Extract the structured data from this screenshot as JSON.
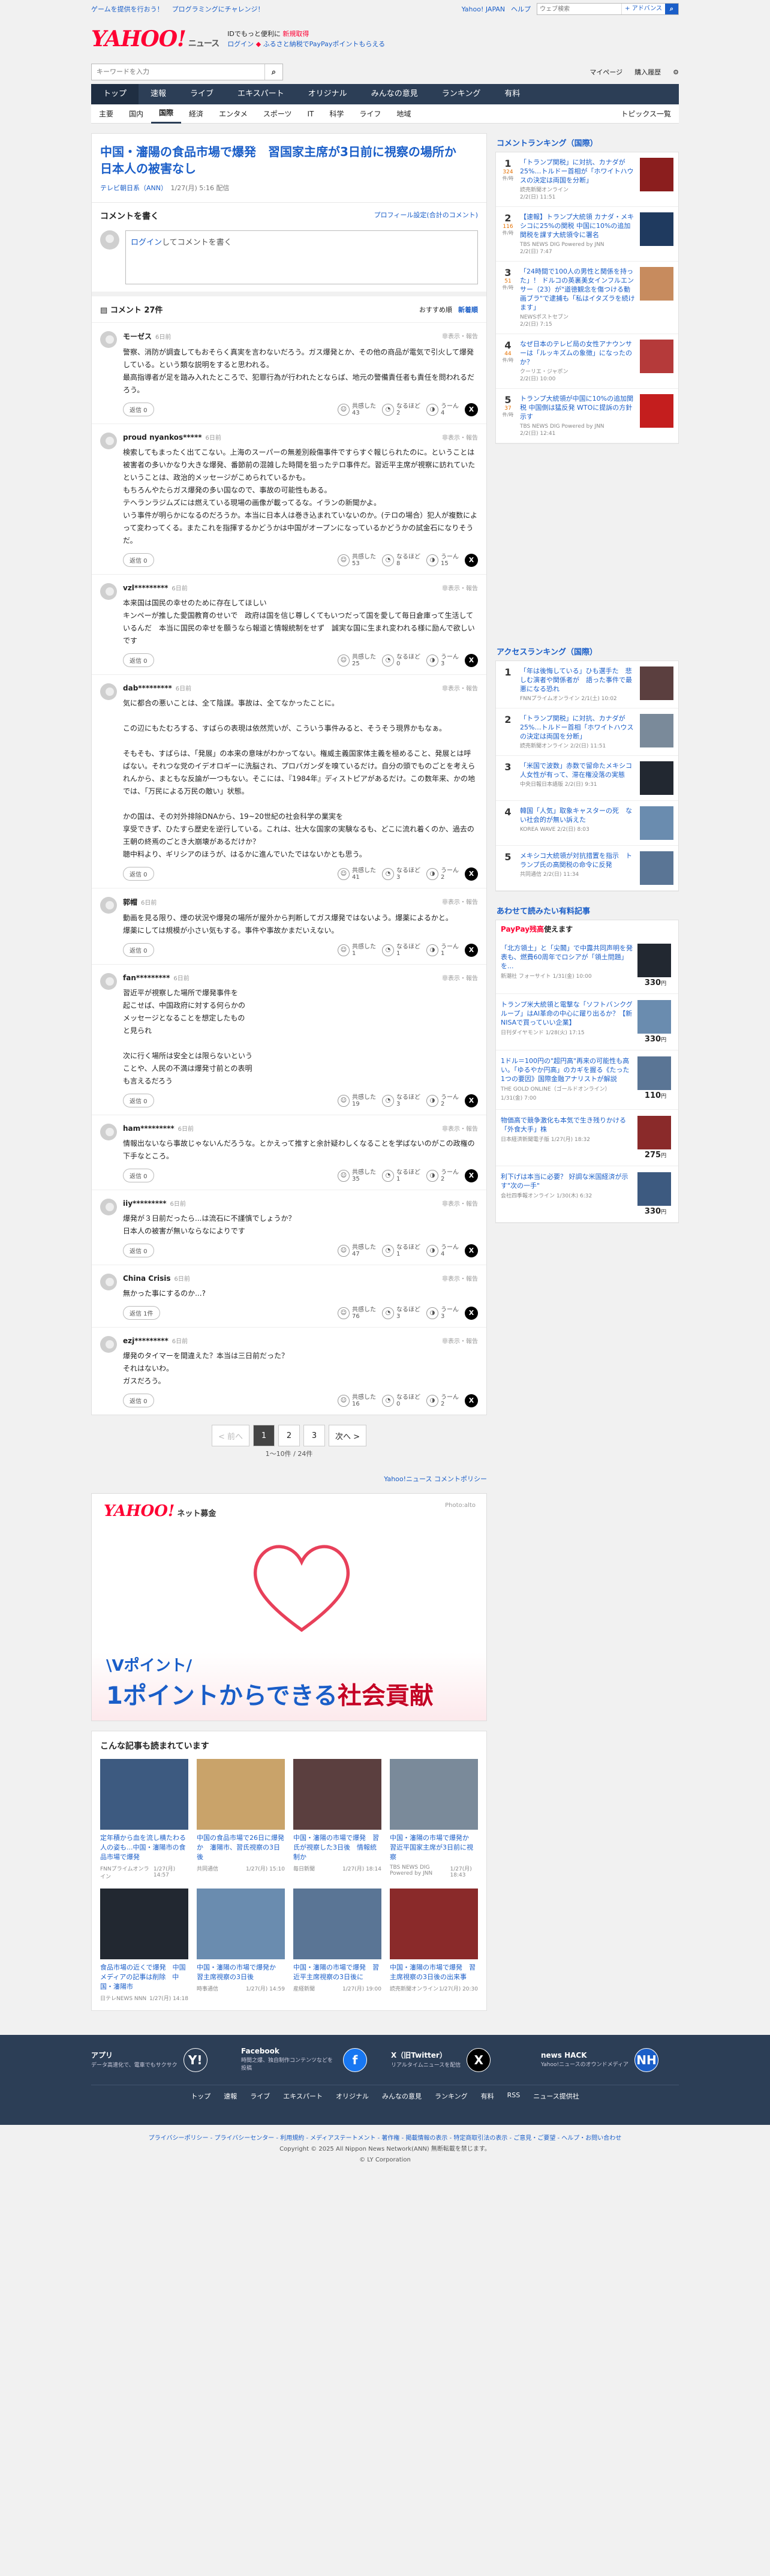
{
  "toplinks": {
    "a": "ゲームを提供を行おう！",
    "b": "プログラミングにチャレンジ！",
    "c": "Yahoo! JAPAN",
    "d": "ヘルプ",
    "search_ph": "ウェブ検索",
    "search_btn": "+ アドバンス"
  },
  "brand": {
    "logo": "YAHOO!",
    "sub": "ニュース",
    "l1a": "IDでもっと便利に",
    "l1b": "新規取得",
    "l2a": "ログイン",
    "l2b": "ふるさと納税でPayPayポイントもらえる"
  },
  "search": {
    "placeholder": "キーワードを入力",
    "mypage": "マイページ",
    "paid": "購入履歴"
  },
  "nav1": [
    "トップ",
    "速報",
    "ライブ",
    "エキスパート",
    "オリジナル",
    "みんなの意見",
    "ランキング",
    "有料"
  ],
  "nav2": [
    "主要",
    "国内",
    "国際",
    "経済",
    "エンタメ",
    "スポーツ",
    "IT",
    "科学",
    "ライフ",
    "地域"
  ],
  "nav2_right": "トピックス一覧",
  "article": {
    "title": "中国・瀋陽の食品市場で爆発　習国家主席が3日前に視察の場所か　日本人の被害なし",
    "source": "テレビ朝日系（ANN）",
    "date": "1/27(月) 5:16 配信"
  },
  "write": {
    "head": "コメントを書く",
    "profile": "プロフィール設定(合計のコメント)",
    "login": "ログイン",
    "ph": "してコメントを書く"
  },
  "list": {
    "count": "コメント 27件",
    "sort1": "おすすめ順",
    "sort2": "新着順"
  },
  "labels": {
    "reply": "返信",
    "agree": "共感した",
    "think": "なるほど",
    "hmm": "うーん",
    "report": "非表示・報告"
  },
  "comments": [
    {
      "name": "モーゼス",
      "time": "6日前",
      "text": "警察、消防が調査してもおそらく真実を言わないだろう。ガス爆発とか、その他の商品が電気で引火して爆発している。という類な説明をすると思われる。\n最高指導者が足を踏み入れたところで、犯罪行為が行われたとならば、地元の警備責任者も責任を問われるだろう。",
      "r": "返信 0",
      "a": "43",
      "b": "2",
      "c": "4"
    },
    {
      "name": "proud nyankos*****",
      "time": "6日前",
      "text": "検索してもまったく出てこない。上海のスーパーの無差別殺傷事件ですらすぐ報じられたのに。ということは被害者の多いかなり大きな爆発、番節前の混雑した時間を狙ったテロ事件だ。習近平主席が視察に訪れていたということは、政治的メッセージがこめられているかも。\nもちろんやたらガス爆発の多い国なので、事故の可能性もある。\nテヘランラジムズには燃えている現場の画像が載ってるな。イランの新聞かよ。\nいう事件が明らかになるのだろうか。本当に日本人は巻き込まれていないのか。(テロの場合）犯人が複数によって変わってくる。またこれを指揮するかどうかは中国がオープンになっているかどうかの試金石になりそうだ。",
      "r": "返信 0",
      "a": "53",
      "b": "8",
      "c": "15"
    },
    {
      "name": "vzl*********",
      "time": "6日前",
      "text": "本来国は国民の幸せのために存在してほしい\nキンペーが推した愛国教育のせいで　政府は国を信じ尊しくてもいつだって国を愛して毎日倉庫って生活しているんだ　本当に国民の幸せを願うなら報道と情報統制をせず　誠実な国に生まれ変われる様に励んで欲しいです",
      "r": "返信 0",
      "a": "25",
      "b": "0",
      "c": "3"
    },
    {
      "name": "dab*********",
      "time": "6日前",
      "text": "気に都合の悪いことは、全て陰謀。事故は、全てなかったことに。\n\nこの辺にもたむろする、すばらの表現は依然荒いが、こういう事件みると、そうそう現界かもなぁ。\n\nそもそも、すばらは、「発展」の本来の意味がわかってない。権威主義国家体主義を極めること、発展とは呼ばない。それつな党のイデオロギーに洗脳され、プロパガンダを嗅ているだけ。自分の頭でものごとを考えられんから、まともな反論が一つもない。そこには、『1984年』ディストピアがあるだけ。この数年来、かの地では、「万民による万民の敵い」状態。\n\nかの国は、その対外排除DNAから、19~20世紀の社会科学の業実を\n享受できず、ひたすら歴史を逆行している。これは、壮大な国家の実験なるも、どこに流れ着くのか、過去の王朝の終焉のごとき大崩壊があるだけか？\n聴中料より、ギリシアのほうが、はるかに進んでいたではないかとも思う。",
      "r": "返信 0",
      "a": "41",
      "b": "3",
      "c": "2"
    },
    {
      "name": "郭帽",
      "time": "6日前",
      "text": "動画を見る限り、煙の状況や爆発の場所が屋外から判断してガス爆発ではないよう。爆薬によるかと。\n爆薬にしては規模が小さい気もする。事件や事故かまだいえない。",
      "r": "返信 0",
      "a": "1",
      "b": "1",
      "c": "1"
    },
    {
      "name": "fan*********",
      "time": "6日前",
      "text": "習近平が視察した場所で爆発事件を\n起こせば、中国政府に対する何らかの\nメッセージとなることを想定したもの\nと見られ\n\n次に行く場所は安全とは限らないという\nことや、人民の不満は爆発寸前との表明\nも言えるだろう",
      "r": "返信 0",
      "a": "19",
      "b": "3",
      "c": "2"
    },
    {
      "name": "ham*********",
      "time": "6日前",
      "text": "情報出ないなら事故じゃないんだろうな。とかえって推すと余計疑わしくなることを学ばないのがこの政権の下手なところ。",
      "r": "返信 0",
      "a": "35",
      "b": "1",
      "c": "2"
    },
    {
      "name": "iiy*********",
      "time": "6日前",
      "text": "爆発が３日前だったら...は流石に不謹慎でしょうか？\n日本人の被害が無いならなによりです",
      "r": "返信 0",
      "a": "47",
      "b": "1",
      "c": "4"
    },
    {
      "name": "China Crisis",
      "time": "6日前",
      "text": "無かった事にするのか...?",
      "r": "返信 1件",
      "a": "76",
      "b": "3",
      "c": "3"
    },
    {
      "name": "ezj*********",
      "time": "6日前",
      "text": "爆発のタイマーを間違えた？本当は三日前だった？\nそれはないわ。\nガスだろう。",
      "r": "返信 0",
      "a": "16",
      "b": "0",
      "c": "2"
    }
  ],
  "pager": {
    "prev": "< 前へ",
    "p1": "1",
    "p2": "2",
    "p3": "3",
    "next": "次へ >",
    "info": "1〜10件 / 24件"
  },
  "policy": "Yahoo!ニュース コメントポリシー",
  "banner": {
    "logo": "YAHOO!",
    "logo_sub": "ネット募金",
    "photo": "Photo:alto",
    "t1": "\\Vポイント/",
    "t2a": "1ポイントからできる",
    "t2b": "社会貢献"
  },
  "read": {
    "head": "こんな記事も読まれています",
    "items": [
      {
        "title": "定年積から血を流し横たわる人の姿も...中国・瀋陽市の食品市場で爆発",
        "src": "FNNプライムオンライン",
        "date": "1/27(月) 14:57"
      },
      {
        "title": "中国の食品市場で26日に爆発か　瀋陽市、習氏視察の3日後",
        "src": "共同通信",
        "date": "1/27(月) 15:10"
      },
      {
        "title": "中国・瀋陽の市場で爆発　習氏が視察した3日後　情報統制か",
        "src": "毎日新聞",
        "date": "1/27(月) 18:14"
      },
      {
        "title": "中国・瀋陽の市場で爆発か　習近平国家主席が3日前に視察",
        "src": "TBS NEWS DIG Powered by JNN",
        "date": "1/27(月) 18:43"
      },
      {
        "title": "食品市場の近くで爆発　中国メディアの記事は削除　中国・瀋陽市",
        "src": "日テレNEWS NNN",
        "date": "1/27(月) 14:18"
      },
      {
        "title": "中国・瀋陽の市場で爆発か　習主席視察の3日後",
        "src": "時事通信",
        "date": "1/27(月) 14:59"
      },
      {
        "title": "中国・瀋陽の市場で爆発　習近平主席視察の3日後に",
        "src": "産経新聞",
        "date": "1/27(月) 19:00"
      },
      {
        "title": "中国・瀋陽の市場で爆発　習主席視察の3日後の出来事",
        "src": "読売新聞オンライン",
        "date": "1/27(月) 20:30"
      }
    ]
  },
  "side": {
    "cmt_rank_head": "コメントランキング（国際）",
    "cmt_rank": [
      {
        "n": "1",
        "c": "324",
        "e": "件/時",
        "t": "「トランプ関税」に対抗、カナダが25%…トルドー首相が「ホワイトハウスの決定は両国を分断」",
        "s": "読売新聞オンライン",
        "d": "2/2(日) 11:51"
      },
      {
        "n": "2",
        "c": "116",
        "e": "件/時",
        "t": "【速報】トランプ大統領 カナダ・メキシコに25%の関税 中国に10%の追加関税を課す大統領令に署名",
        "s": "TBS NEWS DIG Powered by JNN",
        "d": "2/2(日) 7:47"
      },
      {
        "n": "3",
        "c": "51",
        "e": "件/時",
        "t": "「24時間で100人の男性と関係を持った」！ ドルコの英裏美女インフルエンサー（23）が\"道徳観念を傷つける動画ブラ\"で逮捕も「私はイタズラを続けます」",
        "s": "NEWSポストセブン",
        "d": "2/2(日) 7:15"
      },
      {
        "n": "4",
        "c": "44",
        "e": "件/時",
        "t": "なぜ日本のテレビ局の女性アナウンサーは「ルッキズムの象徴」になったのか？",
        "s": "クーリエ・ジャポン",
        "d": "2/2(日) 10:00"
      },
      {
        "n": "5",
        "c": "37",
        "e": "件/時",
        "t": "トランプ大統領が中国に10%の追加関税 中国側は猛反発 WTOに提訴の方針示す",
        "s": "TBS NEWS DIG Powered by JNN",
        "d": "2/2(日) 12:41"
      }
    ],
    "acc_rank_head": "アクセスランキング（国際）",
    "acc_rank": [
      {
        "n": "1",
        "t": "「年は後悔している」ひも選手た　悲しむ演者や関係者が　語った事件で最悪になる恐れ",
        "s": "FNNプライムオンライン",
        "d": "2/1(土) 10:02"
      },
      {
        "n": "2",
        "t": "「トランプ関税」に対抗、カナダが25%…トルドー首相「ホワイトハウスの決定は両国を分断」",
        "s": "読売新聞オンライン",
        "d": "2/2(日) 11:51"
      },
      {
        "n": "3",
        "t": "「米国で波数」赤数で留命たメキシコ人女性が有って、滞在権没落の実態",
        "s": "中央日報日本語版",
        "d": "2/2(日) 9:31"
      },
      {
        "n": "4",
        "t": "韓国「人気」取象キャスターの死　ない社会的が無い訴えた",
        "s": "KOREA WAVE",
        "d": "2/2(日) 8:03"
      },
      {
        "n": "5",
        "t": "メキシコ大統領が対抗措置を指示　トランプ氏の高関税の命令に反発",
        "s": "共同通信",
        "d": "2/2(日) 11:34"
      }
    ],
    "pay_head": "あわせて読みたい有料記事",
    "paypay": "PayPay残高",
    "paypay_tail": "使えます",
    "paid": [
      {
        "t": "「北方領土」と「尖閣」で中露共同声明を発表も、燃費60周年でロシアが「領土問題」を...",
        "s": "新潮社 フォーサイト",
        "d": "1/31(金) 10:00",
        "p": "330",
        "u": "円"
      },
      {
        "t": "トランプ米大統領と電撃な「ソフトバンクグループ」はAI革命の中心に躍り出るか？【新NISAで買っていい企業】",
        "s": "日刊ダイヤモンド",
        "d": "1/28(火) 17:15",
        "p": "330",
        "u": "円"
      },
      {
        "t": "1ドル＝100円の\"超円高\"再来の可能性も高い。「ゆるやか円高」のカギを握る《たった1つの要因》国際金融アナリストが解説",
        "s": "THE GOLD ONLINE（ゴールドオンライン）",
        "d": "1/31(金) 7:00",
        "p": "110",
        "u": "円"
      },
      {
        "t": "物価高で競争激化も本気で生き残りかける「外食大手」株",
        "s": "日本経済新聞電子版",
        "d": "1/27(月) 18:32",
        "p": "275",
        "u": "円"
      },
      {
        "t": "利下げは本当に必要？ 好調な米国経済が示す\"次の一手\"",
        "s": "会社四季報オンライン",
        "d": "1/30(木) 6:32",
        "p": "330",
        "u": "円"
      }
    ]
  },
  "footer": {
    "apps": [
      {
        "name": "アプリ",
        "desc": "データ高速化で、電車でもサクサク",
        "icon": "Y!"
      },
      {
        "name": "Facebook",
        "desc": "時間之爆、独自制作コンテンツなどを投稿",
        "icon": "f"
      },
      {
        "name": "X（旧Twitter）",
        "desc": "リアルタイムニュースを配信",
        "icon": "X"
      },
      {
        "name": "news HACK",
        "desc": "Yahoo!ニュースのオウンドメディア",
        "icon": "NH"
      }
    ],
    "nav": [
      "トップ",
      "速報",
      "ライブ",
      "エキスパート",
      "オリジナル",
      "みんなの意見",
      "ランキング",
      "有料",
      "RSS",
      "ニュース提供社"
    ],
    "links": "プライバシーポリシー - プライバシーセンター - 利用規約 - メディアステートメント - 著作権 - 掲載情報の表示 - 特定商取引法の表示 - ご意見・ご要望 - ヘルプ・お問い合わせ",
    "copy1": "Copyright © 2025 All Nippon News Network(ANN) 無断転載を禁じます。",
    "copy2": "© LY Corporation"
  }
}
